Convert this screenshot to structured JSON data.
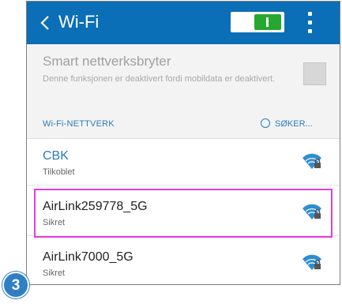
{
  "appbar": {
    "title": "Wi-Fi",
    "toggle_state": "on",
    "accent_color": "#0a6fb6"
  },
  "smart_network_switch": {
    "title": "Smart nettverksbryter",
    "description": "Denne funksjonen er deaktivert fordi mobildata er deaktivert.",
    "checked": false
  },
  "section": {
    "label": "Wi-Fi-NETTVERK",
    "scan_status": "SØKER..."
  },
  "networks": [
    {
      "name": "CBK",
      "status": "Tilkoblet",
      "icon": "wifi-locked-icon"
    },
    {
      "name": "AirLink259778_5G",
      "status": "Sikret",
      "icon": "wifi-locked-icon"
    },
    {
      "name": "AirLink7000_5G",
      "status": "Sikret",
      "icon": "wifi-locked-icon"
    }
  ],
  "step_badge": "3"
}
